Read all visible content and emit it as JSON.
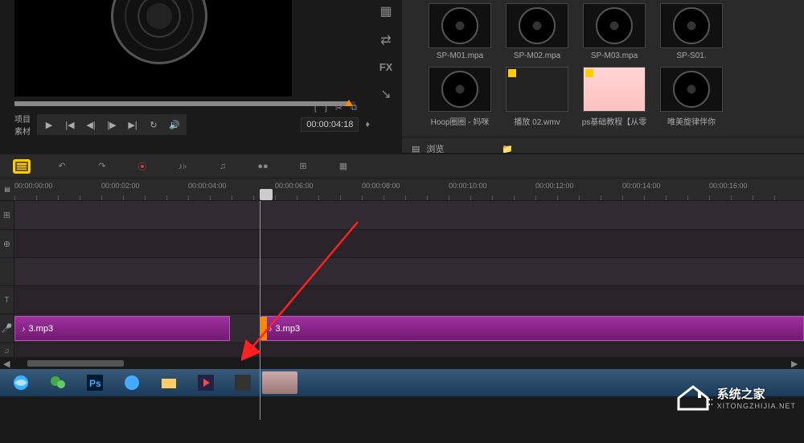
{
  "preview": {
    "project_label": "项目",
    "source_label": "素材",
    "timecode": "00:00:04:18"
  },
  "side_tools": {
    "fx_label": "FX"
  },
  "media": {
    "items": [
      {
        "label": "SP-M01.mpa",
        "type": "disc"
      },
      {
        "label": "SP-M02.mpa",
        "type": "disc"
      },
      {
        "label": "SP-M03.mpa",
        "type": "disc"
      },
      {
        "label": "SP-S01.",
        "type": "disc"
      },
      {
        "label": "Hoop圈圈 - 妈咪",
        "type": "disc"
      },
      {
        "label": "播放 02.wmv",
        "type": "video"
      },
      {
        "label": "ps基础教程【从零",
        "type": "pink"
      },
      {
        "label": "唯美旋律伴你",
        "type": "disc"
      }
    ],
    "browse_label": "浏览"
  },
  "ruler": {
    "marks": [
      "00:00:00:00",
      "00:00:02:00",
      "00:00:04:00",
      "00:00:06:00",
      "00:00:08:00",
      "00:00:10:00",
      "00:00:12:00",
      "00:00:14:00",
      "00:00:16:00"
    ]
  },
  "clips": {
    "clip1": "3.mp3",
    "clip2": "3.mp3"
  },
  "watermark": {
    "title": "系统之家",
    "url": "XITONGZHIJIA.NET"
  },
  "colors": {
    "clip": "#8a2a8a",
    "accent": "#ff8800"
  }
}
